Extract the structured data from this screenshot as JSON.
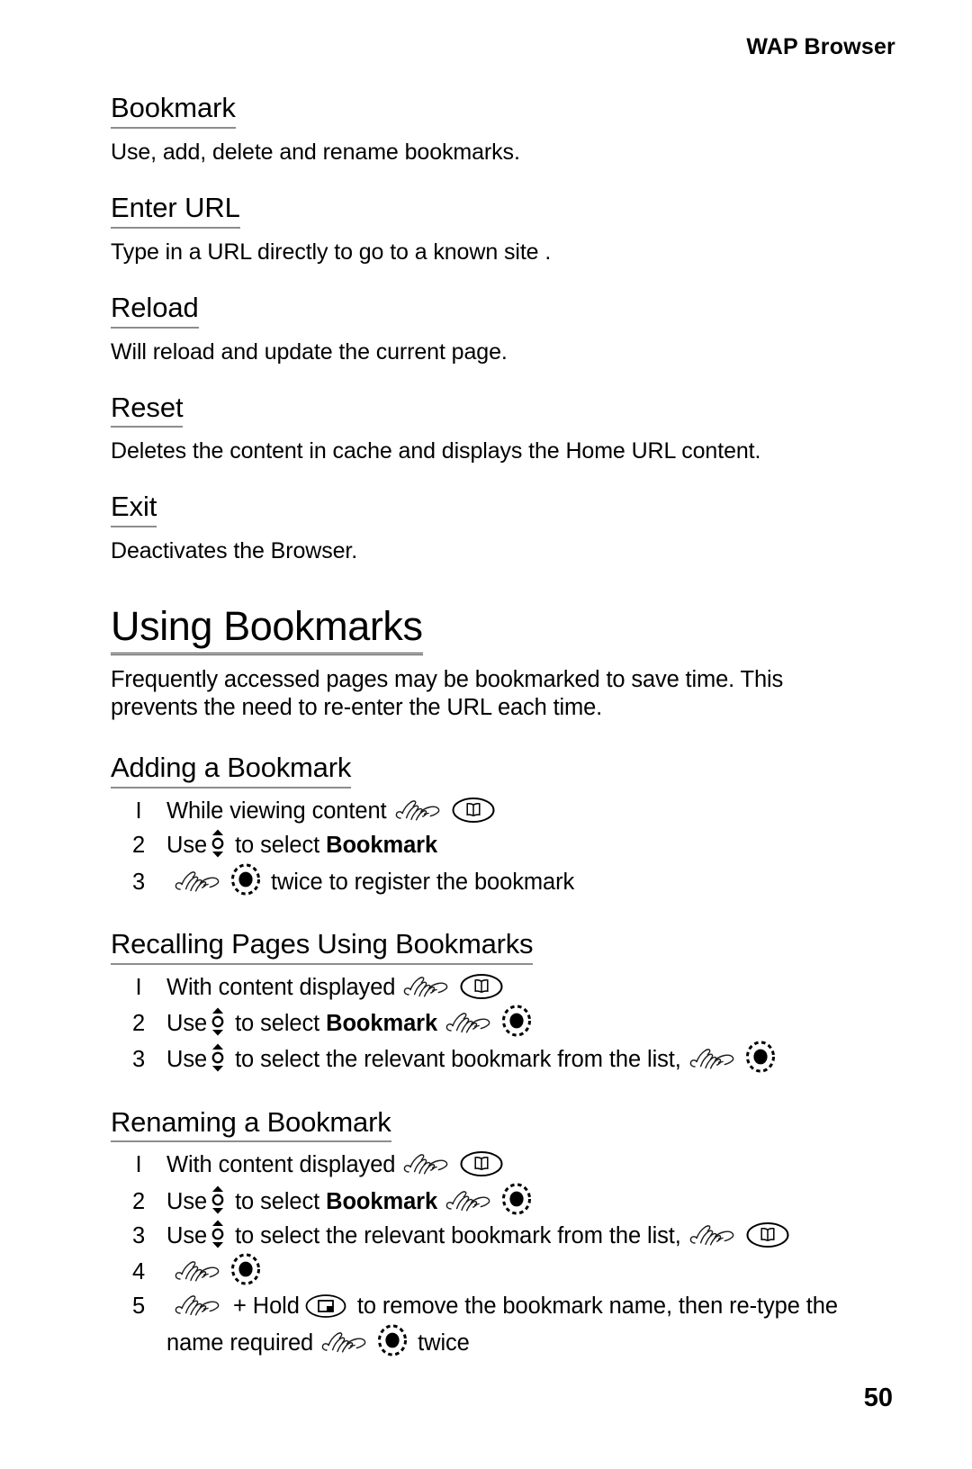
{
  "header": {
    "running_title": "WAP Browser"
  },
  "sections": [
    {
      "heading": "Bookmark",
      "body": "Use, add, delete and rename bookmarks."
    },
    {
      "heading": "Enter URL",
      "body": "Type in a URL directly to go to a known site ."
    },
    {
      "heading": "Reload",
      "body": "Will reload and update the current page."
    },
    {
      "heading": "Reset",
      "body": "Deletes the content in cache and displays the Home URL content."
    },
    {
      "heading": "Exit",
      "body": "Deactivates the Browser."
    }
  ],
  "chapter": {
    "heading": "Using Bookmarks",
    "intro": "Frequently accessed pages may be bookmarked to save time. This prevents the need to re-enter the URL each time."
  },
  "procedures": [
    {
      "heading": "Adding a Bookmark",
      "steps": [
        {
          "num": "I",
          "pre": "While viewing content",
          "post": ""
        },
        {
          "num": "2",
          "pre": "Use",
          "mid": "to select",
          "bold": "Bookmark",
          "post": ""
        },
        {
          "num": "3",
          "pre": "",
          "post": "twice to register the bookmark"
        }
      ]
    },
    {
      "heading": "Recalling Pages Using Bookmarks",
      "steps": [
        {
          "num": "I",
          "pre": "With content displayed",
          "post": ""
        },
        {
          "num": "2",
          "pre": "Use",
          "mid": "to select",
          "bold": "Bookmark",
          "post": ""
        },
        {
          "num": "3",
          "pre": "Use",
          "mid": "to select the relevant bookmark from the list,",
          "post": ""
        }
      ]
    },
    {
      "heading": "Renaming a Bookmark",
      "steps": [
        {
          "num": "I",
          "pre": "With content displayed",
          "post": ""
        },
        {
          "num": "2",
          "pre": "Use",
          "mid": "to select",
          "bold": "Bookmark",
          "post": ""
        },
        {
          "num": "3",
          "pre": "Use",
          "mid": "to select the relevant bookmark from the list,",
          "post": ""
        },
        {
          "num": "4",
          "pre": "",
          "post": ""
        },
        {
          "num": "5",
          "plus": "+ Hold",
          "mid": "to remove the bookmark name, then re-type the name required",
          "post": "twice"
        }
      ]
    }
  ],
  "icons": {
    "press_hand": "pointing-hand-icon",
    "browser_key": "book-key-icon",
    "select_key": "select-key-icon",
    "nav_key": "up-down-nav-key-icon",
    "clear_key": "clear-key-icon"
  },
  "footer": {
    "page_number": "50"
  }
}
